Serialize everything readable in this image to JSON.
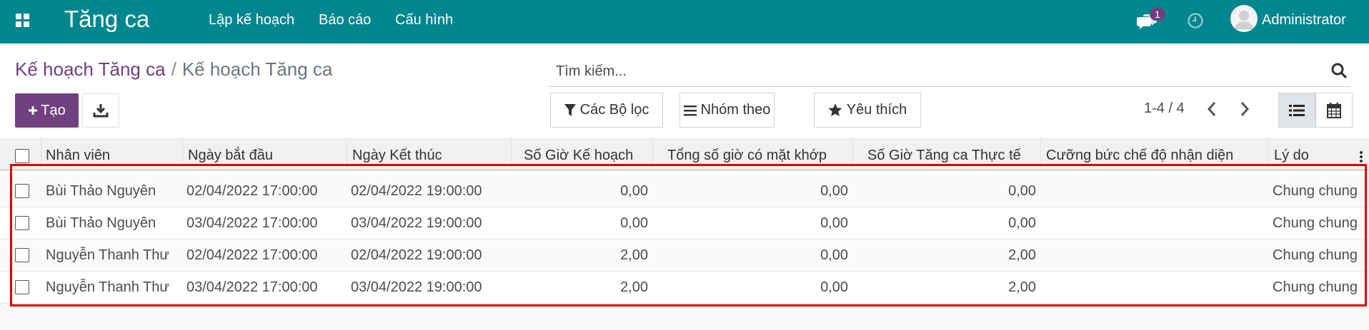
{
  "app": {
    "title": "Tăng ca",
    "menu": [
      {
        "label": "Lập kế hoạch"
      },
      {
        "label": "Báo cáo"
      },
      {
        "label": "Cấu hình"
      }
    ],
    "notification_count": "1",
    "user_name": "Administrator"
  },
  "breadcrumb": {
    "parent": "Kế hoạch Tăng ca",
    "separator": "/",
    "current": "Kế hoạch Tăng ca"
  },
  "search": {
    "placeholder": "Tìm kiếm..."
  },
  "buttons": {
    "create": "Tạo",
    "filters": "Các Bộ lọc",
    "group_by": "Nhóm theo",
    "favorites": "Yêu thích"
  },
  "pager": {
    "text": "1-4 / 4"
  },
  "table": {
    "columns": [
      "Nhân viên",
      "Ngày bắt đầu",
      "Ngày Kết thúc",
      "Số Giờ Kế hoạch",
      "Tổng số giờ có mặt khớp",
      "Số Giờ Tăng ca Thực tế",
      "Cưỡng bức chế độ nhận diện",
      "Lý do"
    ],
    "rows": [
      {
        "employee": "Bùi Thảo Nguyên",
        "start": "02/04/2022 17:00:00",
        "end": "02/04/2022 19:00:00",
        "planned": "0,00",
        "matched": "0,00",
        "actual": "0,00",
        "forced": "",
        "reason": "Chung chung"
      },
      {
        "employee": "Bùi Thảo Nguyên",
        "start": "03/04/2022 17:00:00",
        "end": "03/04/2022 19:00:00",
        "planned": "0,00",
        "matched": "0,00",
        "actual": "0,00",
        "forced": "",
        "reason": "Chung chung"
      },
      {
        "employee": "Nguyễn Thanh Thư",
        "start": "02/04/2022 17:00:00",
        "end": "02/04/2022 19:00:00",
        "planned": "2,00",
        "matched": "0,00",
        "actual": "2,00",
        "forced": "",
        "reason": "Chung chung"
      },
      {
        "employee": "Nguyễn Thanh Thư",
        "start": "03/04/2022 17:00:00",
        "end": "03/04/2022 19:00:00",
        "planned": "2,00",
        "matched": "0,00",
        "actual": "2,00",
        "forced": "",
        "reason": "Chung chung"
      }
    ]
  },
  "colors": {
    "navbar": "#00868f",
    "primary": "#71407f",
    "highlight": "#e00000"
  },
  "icons": [
    "apps-grid-icon",
    "chat-icon",
    "clock-icon",
    "avatar-icon",
    "search-icon",
    "plus-icon",
    "download-icon",
    "filter-icon",
    "bars-icon",
    "star-icon",
    "chevron-left-icon",
    "chevron-right-icon",
    "list-view-icon",
    "calendar-view-icon",
    "column-options-icon"
  ]
}
